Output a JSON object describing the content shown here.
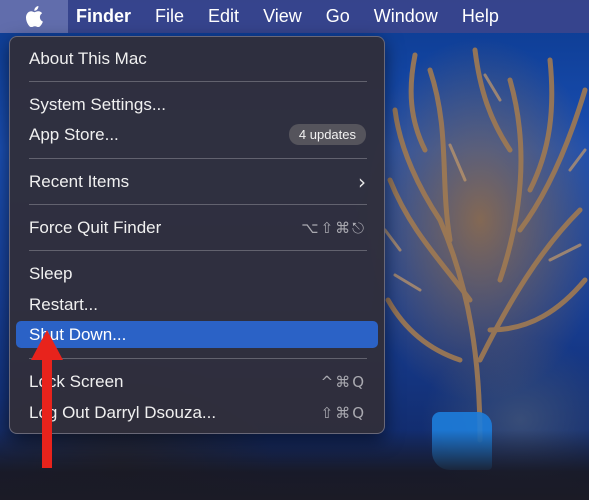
{
  "menubar": {
    "apple_icon": "apple-icon",
    "app_name": "Finder",
    "items": [
      "File",
      "Edit",
      "View",
      "Go",
      "Window",
      "Help"
    ]
  },
  "apple_menu": {
    "about": "About This Mac",
    "system_settings": "System Settings...",
    "app_store": {
      "label": "App Store...",
      "badge": "4 updates"
    },
    "recent_items": {
      "label": "Recent Items",
      "submenu_icon": "chevron-right-icon"
    },
    "force_quit": {
      "label": "Force Quit Finder",
      "shortcut": "⌥⇧⌘⎋"
    },
    "sleep": "Sleep",
    "restart": "Restart...",
    "shut_down": "Shut Down...",
    "lock_screen": {
      "label": "Lock Screen",
      "shortcut": "^⌘Q"
    },
    "log_out": {
      "label": "Log Out Darryl Dsouza...",
      "shortcut": "⇧⌘Q"
    },
    "highlighted_item": "Shut Down..."
  },
  "annotation": {
    "arrow_color": "#e8231c",
    "points_to": "Shut Down..."
  },
  "colors": {
    "highlight": "#2b62c6",
    "menu_background": "#302e3a",
    "menubar": "#3c468c"
  }
}
